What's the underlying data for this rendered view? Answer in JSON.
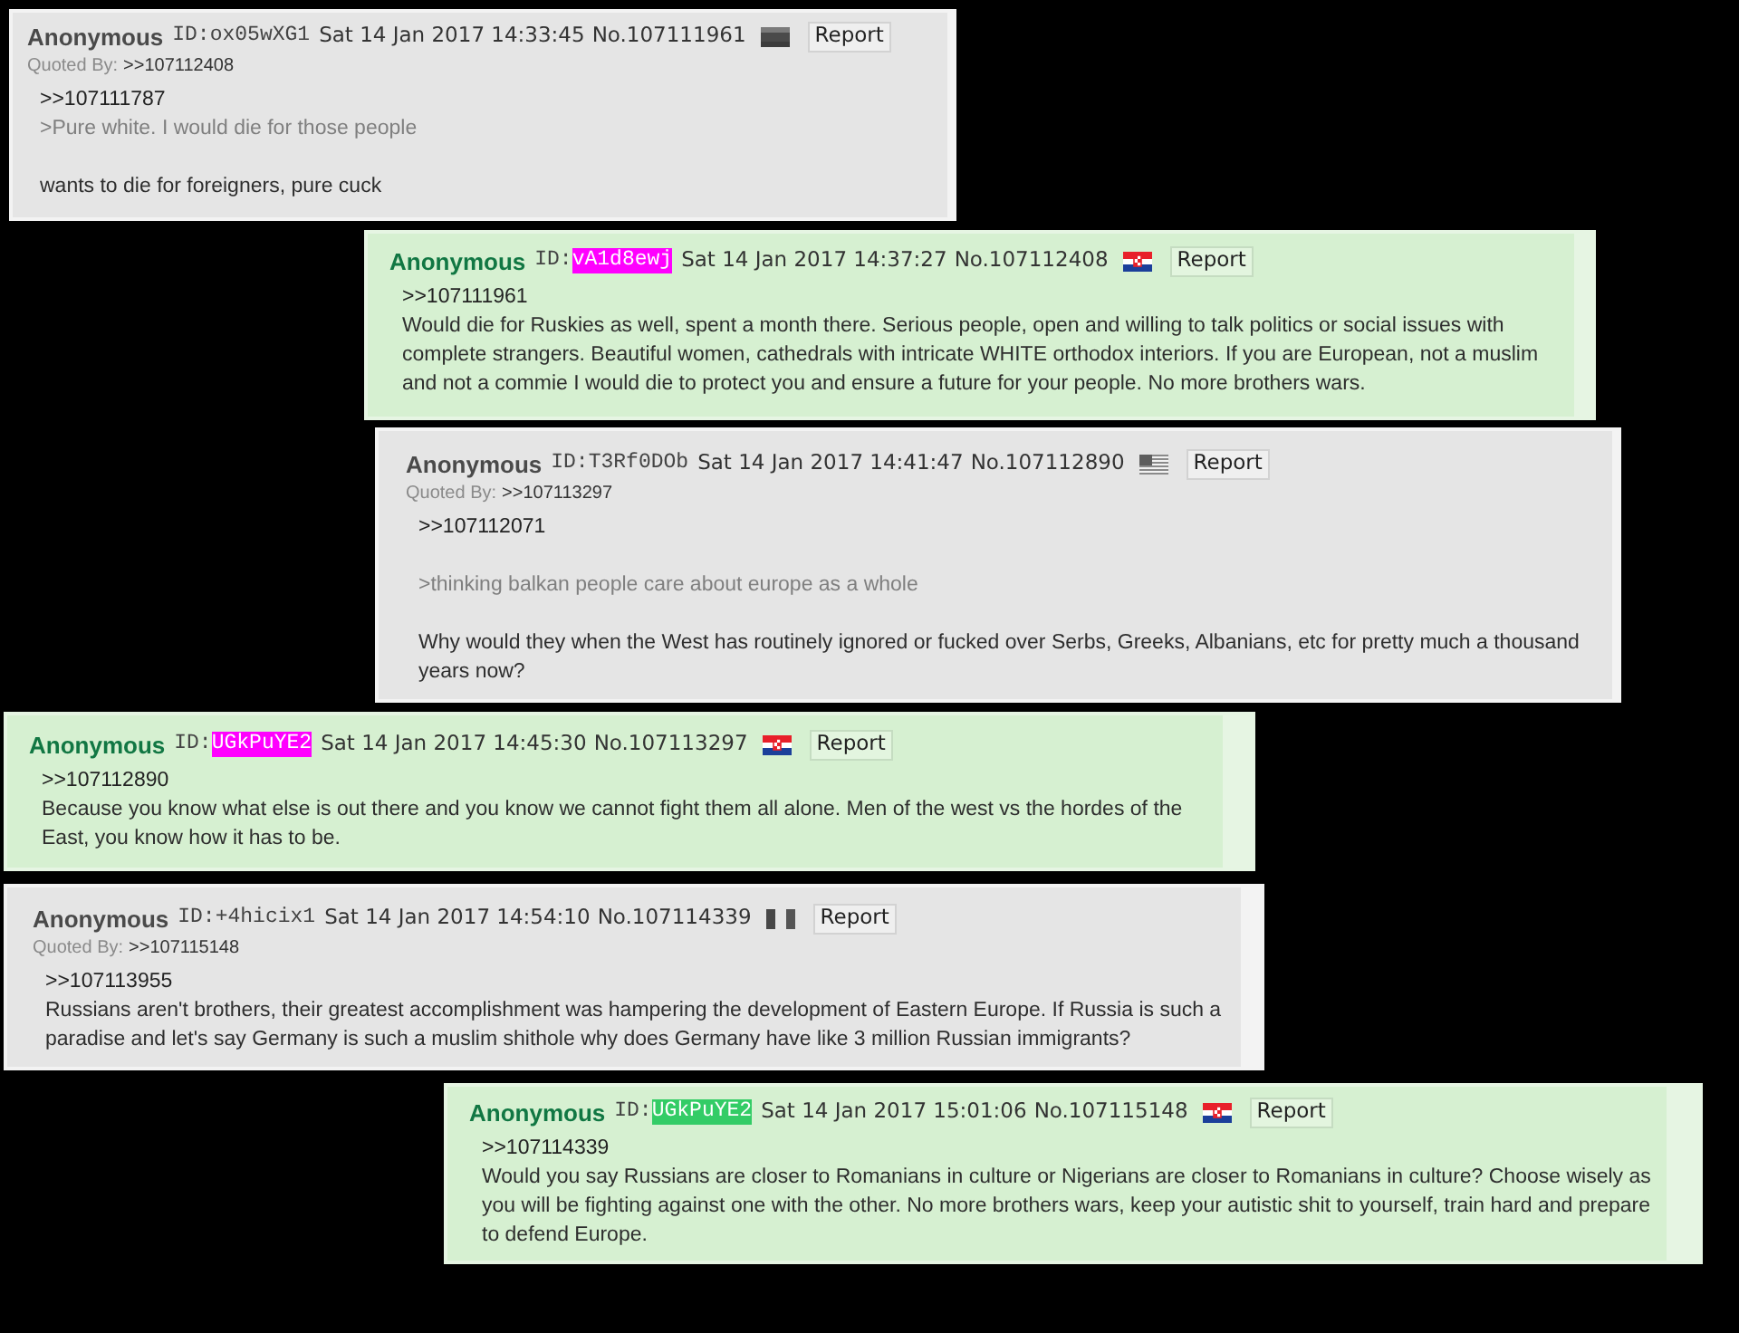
{
  "posts": [
    {
      "highlighted": false,
      "name": "Anonymous",
      "id_label": "ID:",
      "id": {
        "text": "ox05wXG1"
      },
      "date": "Sat 14 Jan 2017 14:33:45",
      "number": "No.107111961",
      "report": "Report",
      "quoted_by": {
        "label": "Quoted By:",
        "link": ">>107112408"
      },
      "body": [
        {
          "kind": "quotelink",
          "text": ">>107111787"
        },
        {
          "kind": "quote",
          "text": ">Pure white. I would die for those people"
        },
        {
          "kind": "break"
        },
        {
          "kind": "text",
          "text": "wants to die for foreigners, pure cuck"
        }
      ]
    },
    {
      "highlighted": true,
      "name": "Anonymous",
      "id_label": "ID:",
      "id": {
        "text": "vA1d8ewj",
        "color": "#ff00ff"
      },
      "date": "Sat 14 Jan 2017 14:37:27",
      "number": "No.107112408",
      "report": "Report",
      "body": [
        {
          "kind": "quotelink",
          "text": ">>107111961"
        },
        {
          "kind": "text",
          "text": "Would die for Ruskies as well, spent a month there. Serious people, open and willing to talk politics or social issues with complete strangers. Beautiful women, cathedrals with intricate WHITE orthodox interiors. If you are European, not a muslim and not a commie I would die to protect you and ensure a future for your people. No more brothers wars."
        }
      ]
    },
    {
      "highlighted": false,
      "name": "Anonymous",
      "id_label": "ID:",
      "id": {
        "text": "T3Rf0DOb"
      },
      "date": "Sat 14 Jan 2017 14:41:47",
      "number": "No.107112890",
      "report": "Report",
      "quoted_by": {
        "label": "Quoted By:",
        "link": ">>107113297"
      },
      "body": [
        {
          "kind": "quotelink",
          "text": ">>107112071"
        },
        {
          "kind": "break"
        },
        {
          "kind": "quote",
          "text": ">thinking balkan people care about europe as a whole"
        },
        {
          "kind": "break"
        },
        {
          "kind": "text",
          "text": "Why would they when the West has routinely ignored or fucked over Serbs, Greeks, Albanians, etc for pretty much a thousand years now?"
        }
      ]
    },
    {
      "highlighted": true,
      "name": "Anonymous",
      "id_label": "ID:",
      "id": {
        "text": "UGkPuYE2",
        "color": "#ff00ff"
      },
      "date": "Sat 14 Jan 2017 14:45:30",
      "number": "No.107113297",
      "report": "Report",
      "body": [
        {
          "kind": "quotelink",
          "text": ">>107112890"
        },
        {
          "kind": "text",
          "text": "Because you know what else is out there and you know we cannot fight them all alone. Men of the west vs the hordes of the East, you know how it has to be."
        }
      ]
    },
    {
      "highlighted": false,
      "name": "Anonymous",
      "id_label": "ID:",
      "id": {
        "text": "+4hicix1"
      },
      "date": "Sat 14 Jan 2017 14:54:10",
      "number": "No.107114339",
      "report": "Report",
      "quoted_by": {
        "label": "Quoted By:",
        "link": ">>107115148"
      },
      "body": [
        {
          "kind": "quotelink",
          "text": ">>107113955"
        },
        {
          "kind": "text",
          "text": "Russians aren't brothers, their greatest accomplishment was hampering the development of Eastern Europe. If Russia is such a paradise and let's say Germany is such a muslim shithole why does Germany have like 3 million Russian immigrants?"
        }
      ]
    },
    {
      "highlighted": true,
      "name": "Anonymous",
      "id_label": "ID:",
      "id": {
        "text": "UGkPuYE2",
        "color": "#33cc66"
      },
      "date": "Sat 14 Jan 2017 15:01:06",
      "number": "No.107115148",
      "report": "Report",
      "body": [
        {
          "kind": "quotelink",
          "text": ">>107114339"
        },
        {
          "kind": "text",
          "text": "Would you say Russians are closer to Romanians in culture or Nigerians are closer to Romanians in culture? Choose wisely as you will be fighting against one with the other. No more brothers wars, keep your autistic shit to yourself, train hard and prepare to defend Europe."
        }
      ]
    }
  ]
}
